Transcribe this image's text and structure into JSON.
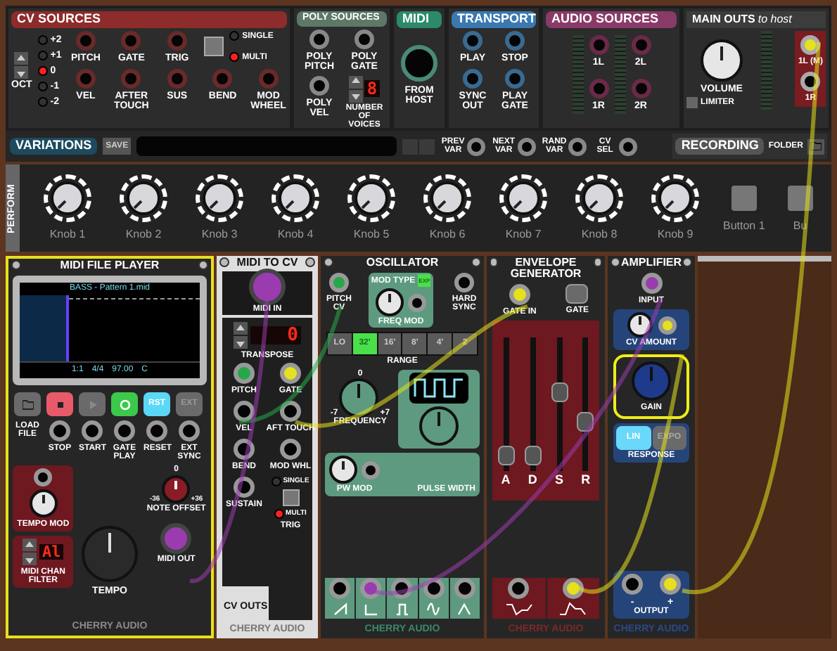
{
  "cv_sources": {
    "title": "CV SOURCES",
    "octave": {
      "label": "OCT",
      "options": [
        {
          "label": "+2",
          "selected": false
        },
        {
          "label": "+1",
          "selected": false
        },
        {
          "label": "0",
          "selected": true
        },
        {
          "label": "-1",
          "selected": false
        },
        {
          "label": "-2",
          "selected": false
        }
      ]
    },
    "jacks_top": [
      "PITCH",
      "GATE",
      "TRIG"
    ],
    "jacks_bottom": [
      "VEL",
      "AFTER TOUCH",
      "SUS",
      "BEND",
      "MOD WHEEL"
    ],
    "trig_mode": [
      {
        "label": "SINGLE",
        "selected": false
      },
      {
        "label": "MULTI",
        "selected": true
      }
    ]
  },
  "poly_sources": {
    "title": "POLY SOURCES",
    "jacks": [
      "POLY PITCH",
      "POLY GATE",
      "POLY VEL"
    ],
    "voices_label": "NUMBER OF VOICES",
    "voices_display": "8"
  },
  "midi": {
    "title": "MIDI",
    "jack": "FROM HOST"
  },
  "transport": {
    "title": "TRANSPORT",
    "jacks": [
      "PLAY",
      "STOP",
      "SYNC OUT",
      "PLAY GATE"
    ]
  },
  "audio_sources": {
    "title": "AUDIO SOURCES",
    "jacks": [
      "1L",
      "2L",
      "1R",
      "2R"
    ]
  },
  "main_outs": {
    "title": "MAIN OUTS",
    "title_suffix": "to host",
    "volume": "VOLUME",
    "limiter": {
      "label": "LIMITER",
      "on": false
    },
    "jacks": [
      {
        "label": "1L (M)",
        "color": "#e6e01e"
      },
      {
        "label": "1R"
      }
    ]
  },
  "variations": {
    "title": "VARIATIONS",
    "save": "SAVE",
    "jacks": [
      "PREV VAR",
      "NEXT VAR",
      "RAND VAR",
      "CV SEL"
    ]
  },
  "recording": {
    "title": "RECORDING",
    "folder": "FOLDER"
  },
  "perform": {
    "title": "PERFORM",
    "knobs": [
      "Knob 1",
      "Knob 2",
      "Knob 3",
      "Knob 4",
      "Knob 5",
      "Knob 6",
      "Knob 7",
      "Knob 8",
      "Knob 9"
    ],
    "buttons": [
      "Button 1",
      "Bu"
    ]
  },
  "midi_file_player": {
    "title": "MIDI FILE PLAYER",
    "file": "BASS - Pattern 1.mid",
    "readouts": [
      "1:1",
      "4/4",
      "97.00",
      "C"
    ],
    "buttons": [
      {
        "kind": "folder",
        "on": false
      },
      {
        "kind": "stop",
        "on": true
      },
      {
        "kind": "play",
        "on": false
      },
      {
        "kind": "loop",
        "on": true
      },
      {
        "kind": "text",
        "label": "RST",
        "on": true
      },
      {
        "kind": "text",
        "label": "EXT",
        "on": false
      }
    ],
    "load_label": "LOAD FILE",
    "jacks": [
      "STOP",
      "START",
      "GATE PLAY",
      "RESET",
      "EXT SYNC"
    ],
    "tempo_mod": "TEMPO MOD",
    "tempo": "TEMPO",
    "note_offset": {
      "label": "NOTE OFFSET",
      "center": "0",
      "min": "-36",
      "max": "+36"
    },
    "midi_out": {
      "label": "MIDI OUT",
      "color": "#9a3cb0"
    },
    "chan_filter": {
      "label": "MIDI CHAN FILTER",
      "display": "Al"
    },
    "brand": "CHERRY AUDIO"
  },
  "midi_to_cv": {
    "title": "MIDI TO CV",
    "midi_in": {
      "label": "MIDI IN",
      "color": "#9a3cb0"
    },
    "transpose": {
      "label": "TRANSPOSE",
      "display": "0"
    },
    "jacks": [
      {
        "label": "PITCH",
        "color": "#26a84a"
      },
      {
        "label": "GATE",
        "color": "#e6e01e"
      },
      {
        "label": "VEL"
      },
      {
        "label": "AFT TOUCH"
      },
      {
        "label": "BEND"
      },
      {
        "label": "MOD WHL"
      },
      {
        "label": "SUSTAIN"
      }
    ],
    "trig_mode": [
      {
        "label": "SINGLE",
        "selected": false
      },
      {
        "label": "MULTI",
        "selected": true
      }
    ],
    "trig_label": "TRIG",
    "outs_label": "CV OUTS",
    "brand": "CHERRY AUDIO"
  },
  "oscillator": {
    "title": "OSCILLATOR",
    "pitch_cv": {
      "label": "PITCH CV",
      "color": "#26a84a"
    },
    "mod_type": {
      "label": "MOD TYPE",
      "button": "EXP",
      "on": true
    },
    "freq_mod": "FREQ MOD",
    "hard_sync": "HARD SYNC",
    "range": [
      {
        "label": "LO",
        "selected": false
      },
      {
        "label": "32'",
        "selected": true
      },
      {
        "label": "16'",
        "selected": false
      },
      {
        "label": "8'",
        "selected": false
      },
      {
        "label": "4'",
        "selected": false
      },
      {
        "label": "2",
        "selected": false
      }
    ],
    "range_label": "RANGE",
    "frequency": {
      "label": "FREQUENCY",
      "center": "0",
      "min": "-7",
      "max": "+7"
    },
    "pw_mod": "PW MOD",
    "pulse_width": "PULSE WIDTH",
    "outputs": [
      {
        "kind": "saw"
      },
      {
        "kind": "ramp",
        "color": "#9a3cb0"
      },
      {
        "kind": "square"
      },
      {
        "kind": "sine"
      },
      {
        "kind": "triangle"
      }
    ],
    "brand": "CHERRY AUDIO"
  },
  "envelope": {
    "title": "ENVELOPE GENERATOR",
    "gate_in": {
      "label": "GATE IN",
      "color": "#e6e01e"
    },
    "gate": "GATE",
    "sliders": [
      {
        "label": "A",
        "level": 0.05
      },
      {
        "label": "D",
        "level": 0.05
      },
      {
        "label": "S",
        "level": 0.6
      },
      {
        "label": "R",
        "level": 0.35
      }
    ],
    "outputs": [
      {
        "kind": "inverted"
      },
      {
        "kind": "normal",
        "color": "#e6e01e"
      }
    ],
    "brand": "CHERRY AUDIO"
  },
  "amplifier": {
    "title": "AMPLIFIER",
    "input": {
      "label": "INPUT",
      "color": "#9a3cb0"
    },
    "cv_amount": {
      "label": "CV AMOUNT",
      "color": "#e6e01e"
    },
    "gain": {
      "label": "GAIN",
      "selected": true
    },
    "response": [
      {
        "label": "LIN",
        "selected": true
      },
      {
        "label": "EXPO",
        "selected": false
      }
    ],
    "response_label": "RESPONSE",
    "output": {
      "label": "OUTPUT",
      "jacks": [
        {
          "label": "-"
        },
        {
          "label": "+",
          "color": "#e6e01e"
        }
      ]
    },
    "brand": "CHERRY AUDIO"
  }
}
